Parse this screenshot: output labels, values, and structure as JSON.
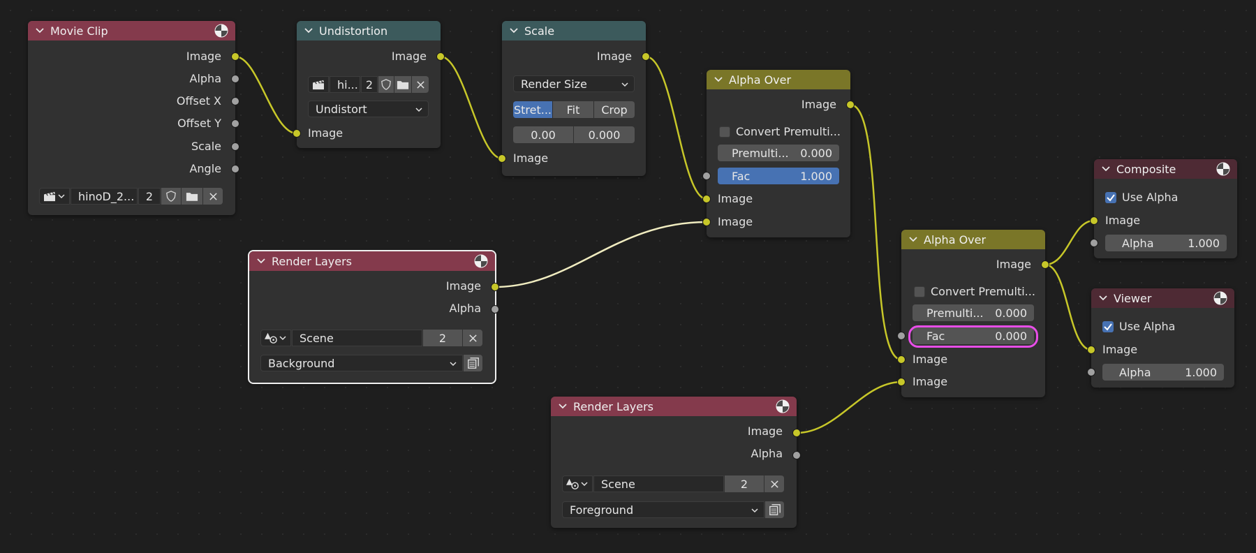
{
  "colors": {
    "yellow_socket": "#c7c729",
    "gray_socket": "#a1a1a1",
    "highlight": "#e84ee8",
    "active_blue": "#4772b3"
  },
  "movie_clip": {
    "title": "Movie Clip",
    "outputs": [
      "Image",
      "Alpha",
      "Offset X",
      "Offset Y",
      "Scale",
      "Angle"
    ],
    "clip_name": "hinoD_2...",
    "users": "2"
  },
  "undistortion": {
    "title": "Undistortion",
    "output": "Image",
    "clip_name": "hi...",
    "users": "2",
    "mode": "Undistort",
    "input": "Image"
  },
  "scale": {
    "title": "Scale",
    "output": "Image",
    "space": "Render Size",
    "modes": [
      "Stret...",
      "Fit",
      "Crop"
    ],
    "offset_x": "0.00",
    "offset_y": "0.000",
    "input": "Image"
  },
  "alpha_over_1": {
    "title": "Alpha Over",
    "output": "Image",
    "convert_label": "Convert Premulti...",
    "premul_label": "Premulti...",
    "premul_value": "0.000",
    "fac_label": "Fac",
    "fac_value": "1.000",
    "input1": "Image",
    "input2": "Image"
  },
  "render_layers_1": {
    "title": "Render Layers",
    "outputs": [
      "Image",
      "Alpha"
    ],
    "scene": "Scene",
    "users": "2",
    "layer": "Background"
  },
  "alpha_over_2": {
    "title": "Alpha Over",
    "output": "Image",
    "convert_label": "Convert Premulti...",
    "premul_label": "Premulti...",
    "premul_value": "0.000",
    "fac_label": "Fac",
    "fac_value": "0.000",
    "input1": "Image",
    "input2": "Image"
  },
  "render_layers_2": {
    "title": "Render Layers",
    "outputs": [
      "Image",
      "Alpha"
    ],
    "scene": "Scene",
    "users": "2",
    "layer": "Foreground"
  },
  "composite": {
    "title": "Composite",
    "use_alpha": "Use Alpha",
    "input": "Image",
    "alpha_label": "Alpha",
    "alpha_value": "1.000"
  },
  "viewer": {
    "title": "Viewer",
    "use_alpha": "Use Alpha",
    "input": "Image",
    "alpha_label": "Alpha",
    "alpha_value": "1.000"
  }
}
